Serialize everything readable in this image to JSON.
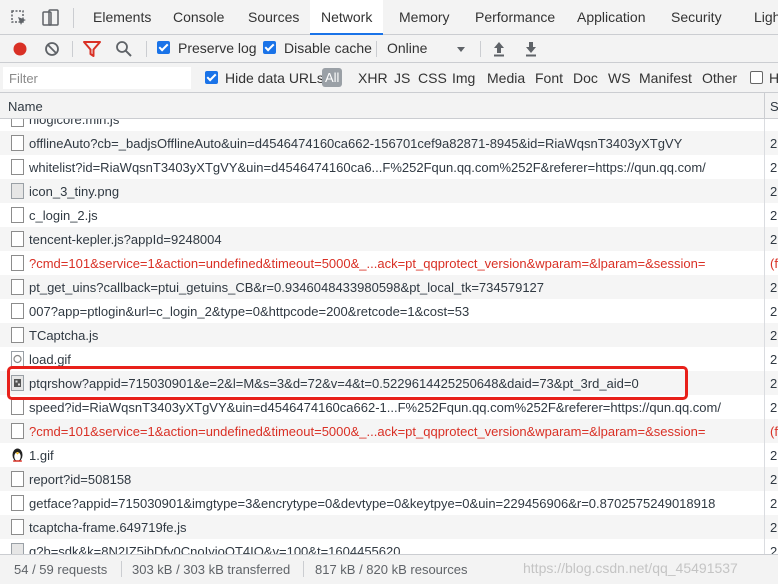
{
  "tabs": [
    {
      "label": "Elements"
    },
    {
      "label": "Console"
    },
    {
      "label": "Sources"
    },
    {
      "label": "Network",
      "active": true
    },
    {
      "label": "Memory"
    },
    {
      "label": "Performance"
    },
    {
      "label": "Application"
    },
    {
      "label": "Security"
    },
    {
      "label": "Ligh"
    }
  ],
  "toolbar": {
    "preserve_log": "Preserve log",
    "disable_cache": "Disable cache",
    "throttle": "Online",
    "record_color": "#d93025",
    "filter_color": "#d93025"
  },
  "filterbar": {
    "placeholder": "Filter",
    "hide_data_urls": "Hide data URLs",
    "types": [
      "All",
      "XHR",
      "JS",
      "CSS",
      "Img",
      "Media",
      "Font",
      "Doc",
      "WS",
      "Manifest",
      "Other"
    ],
    "extra": "H"
  },
  "table": {
    "col_name": "Name",
    "col_status": "S",
    "rows": [
      {
        "name": "hlogicore.min.js",
        "status": "",
        "icon": "doc",
        "error": false
      },
      {
        "name": "offlineAuto?cb=_badjsOfflineAuto&uin=d4546474160ca662-156701cef9a82871-8945&id=RiaWqsnT3403yXTgVY",
        "status": "2",
        "icon": "doc",
        "error": false
      },
      {
        "name": "whitelist?id=RiaWqsnT3403yXTgVY&uin=d4546474160ca6...F%252Fqun.qq.com%252F&referer=https://qun.qq.com/",
        "status": "2",
        "icon": "doc",
        "error": false
      },
      {
        "name": "icon_3_tiny.png",
        "status": "2",
        "icon": "img",
        "error": false
      },
      {
        "name": "c_login_2.js",
        "status": "2",
        "icon": "doc",
        "error": false
      },
      {
        "name": "tencent-kepler.js?appId=9248004",
        "status": "2",
        "icon": "doc",
        "error": false
      },
      {
        "name": "?cmd=101&service=1&action=undefined&timeout=5000&_...ack=pt_qqprotect_version&wparam=&lparam=&session=",
        "status": "(f",
        "icon": "doc",
        "error": true
      },
      {
        "name": "pt_get_uins?callback=ptui_getuins_CB&r=0.9346048433980598&pt_local_tk=734579127",
        "status": "2",
        "icon": "doc",
        "error": false
      },
      {
        "name": "007?app=ptlogin&url=c_login_2&type=0&httpcode=200&retcode=1&cost=53",
        "status": "2",
        "icon": "doc",
        "error": false
      },
      {
        "name": "TCaptcha.js",
        "status": "2",
        "icon": "doc",
        "error": false
      },
      {
        "name": "load.gif",
        "status": "2",
        "icon": "gif",
        "error": false
      },
      {
        "name": "ptqrshow?appid=715030901&e=2&l=M&s=3&d=72&v=4&t=0.5229614425250648&daid=73&pt_3rd_aid=0",
        "status": "2",
        "icon": "qr",
        "error": false
      },
      {
        "name": "speed?id=RiaWqsnT3403yXTgVY&uin=d4546474160ca662-1...F%252Fqun.qq.com%252F&referer=https://qun.qq.com/",
        "status": "2",
        "icon": "doc",
        "error": false
      },
      {
        "name": "?cmd=101&service=1&action=undefined&timeout=5000&_...ack=pt_qqprotect_version&wparam=&lparam=&session=",
        "status": "(f",
        "icon": "doc",
        "error": true
      },
      {
        "name": "1.gif",
        "status": "2",
        "icon": "penguin",
        "error": false
      },
      {
        "name": "report?id=508158",
        "status": "2",
        "icon": "doc",
        "error": false
      },
      {
        "name": "getface?appid=715030901&imgtype=3&encrytype=0&devtype=0&keytpye=0&uin=229456906&r=0.8702575249018918",
        "status": "2",
        "icon": "doc",
        "error": false
      },
      {
        "name": "tcaptcha-frame.649719fe.js",
        "status": "2",
        "icon": "doc",
        "error": false
      },
      {
        "name": "q?b=sdk&k=8N2IZ5ibDfy0CnoIyioQT4IO&v=100&t=1604455620",
        "status": "2",
        "icon": "img",
        "error": false
      }
    ]
  },
  "statusbar": {
    "requests": "54 / 59 requests",
    "transferred": "303 kB / 303 kB transferred",
    "resources": "817 kB / 820 kB resources",
    "watermark": "https://blog.csdn.net/qq_45491537"
  }
}
